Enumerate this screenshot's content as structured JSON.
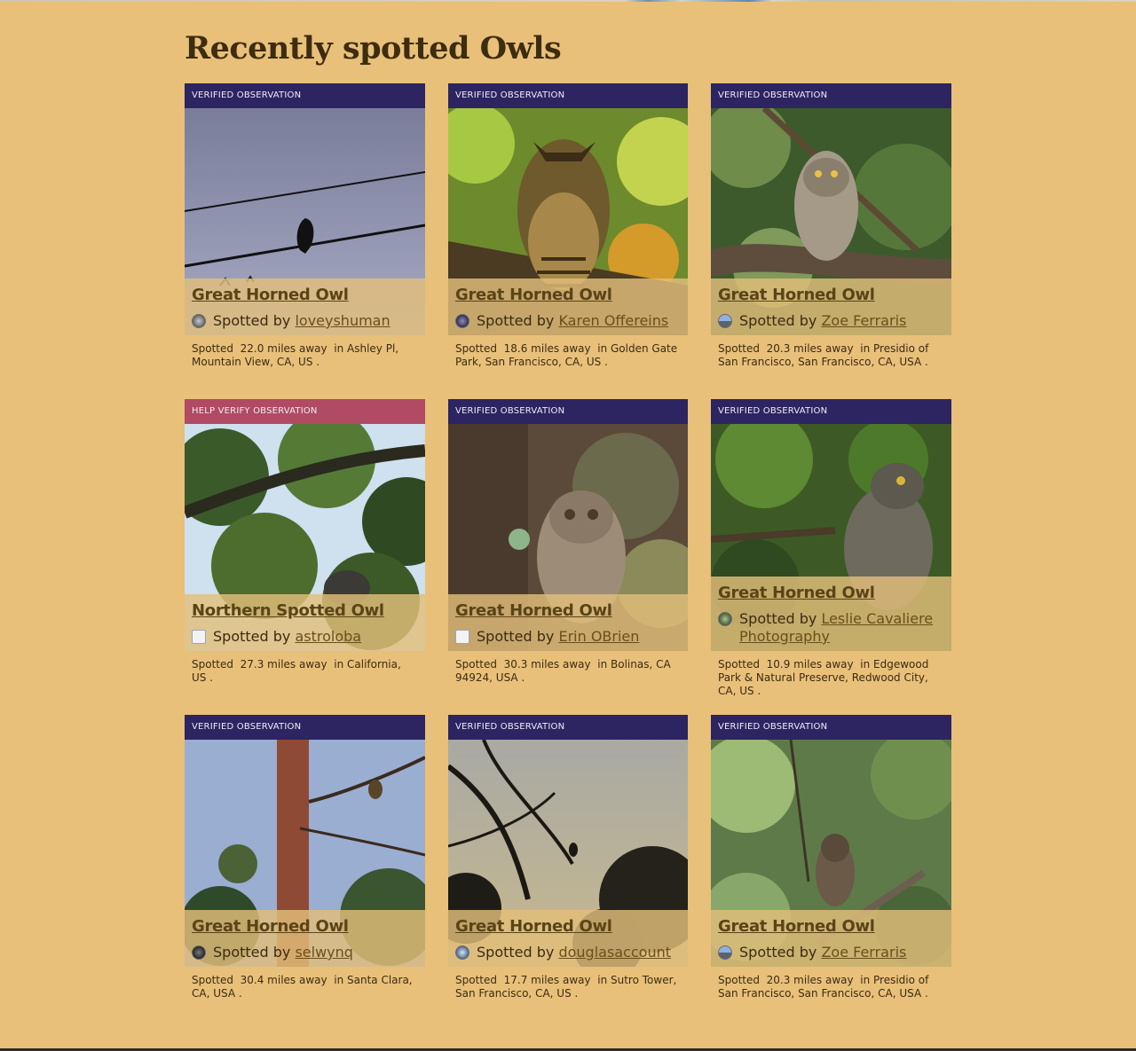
{
  "page": {
    "title": "Recently spotted Owls"
  },
  "colors": {
    "background": "#e8c07a",
    "verified_badge": "#2d2462",
    "help_badge": "#b14a63"
  },
  "cards": [
    {
      "badge": "VERIFIED OBSERVATION",
      "badge_type": "verified",
      "species": "Great Horned Owl",
      "spotted_by_label": "Spotted by",
      "user": "loveyshuman",
      "spotted_label": "Spotted",
      "distance": "22.0 miles away",
      "location": "in Ashley Pl, Mountain View, CA, US ."
    },
    {
      "badge": "VERIFIED OBSERVATION",
      "badge_type": "verified",
      "species": "Great Horned Owl",
      "spotted_by_label": "Spotted by",
      "user": "Karen Offereins",
      "spotted_label": "Spotted",
      "distance": "18.6 miles away",
      "location": "in Golden Gate Park, San Francisco, CA, US ."
    },
    {
      "badge": "VERIFIED OBSERVATION",
      "badge_type": "verified",
      "species": "Great Horned Owl",
      "spotted_by_label": "Spotted by",
      "user": "Zoe Ferraris",
      "spotted_label": "Spotted",
      "distance": "20.3 miles away",
      "location": "in Presidio of San Francisco, San Francisco, CA, USA ."
    },
    {
      "badge": "HELP VERIFY OBSERVATION",
      "badge_type": "help",
      "species": "Northern Spotted Owl",
      "spotted_by_label": "Spotted by",
      "user": "astroloba",
      "spotted_label": "Spotted",
      "distance": "27.3 miles away",
      "location": "in California, US ."
    },
    {
      "badge": "VERIFIED OBSERVATION",
      "badge_type": "verified",
      "species": "Great Horned Owl",
      "spotted_by_label": "Spotted by",
      "user": "Erin OBrien",
      "spotted_label": "Spotted",
      "distance": "30.3 miles away",
      "location": "in Bolinas, CA 94924, USA ."
    },
    {
      "badge": "VERIFIED OBSERVATION",
      "badge_type": "verified",
      "species": "Great Horned Owl",
      "spotted_by_label": "Spotted by",
      "user": "Leslie Cavaliere Photography",
      "spotted_label": "Spotted",
      "distance": "10.9 miles away",
      "location": "in Edgewood Park & Natural Preserve, Redwood City, CA, US ."
    },
    {
      "badge": "VERIFIED OBSERVATION",
      "badge_type": "verified",
      "species": "Great Horned Owl",
      "spotted_by_label": "Spotted by",
      "user": "selwynq",
      "spotted_label": "Spotted",
      "distance": "30.4 miles away",
      "location": "in Santa Clara, CA, USA ."
    },
    {
      "badge": "VERIFIED OBSERVATION",
      "badge_type": "verified",
      "species": "Great Horned Owl",
      "spotted_by_label": "Spotted by",
      "user": "douglasaccount",
      "spotted_label": "Spotted",
      "distance": "17.7 miles away",
      "location": "in Sutro Tower, San Francisco, CA, US ."
    },
    {
      "badge": "VERIFIED OBSERVATION",
      "badge_type": "verified",
      "species": "Great Horned Owl",
      "spotted_by_label": "Spotted by",
      "user": "Zoe Ferraris",
      "spotted_label": "Spotted",
      "distance": "20.3 miles away",
      "location": "in Presidio of San Francisco, San Francisco, CA, USA ."
    }
  ]
}
